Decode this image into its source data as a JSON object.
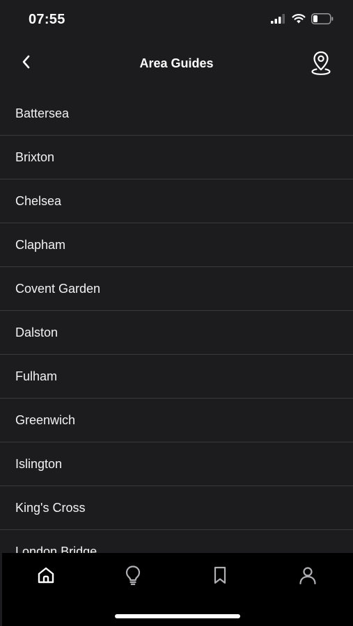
{
  "status_bar": {
    "time": "07:55",
    "icons": [
      "signal-icon",
      "wifi-icon",
      "battery-icon"
    ]
  },
  "header": {
    "title": "Area Guides",
    "back_icon": "chevron-left-icon",
    "map_icon": "map-pin-icon"
  },
  "areas": [
    {
      "label": "Battersea"
    },
    {
      "label": "Brixton"
    },
    {
      "label": "Chelsea"
    },
    {
      "label": "Clapham"
    },
    {
      "label": "Covent Garden"
    },
    {
      "label": "Dalston"
    },
    {
      "label": "Fulham"
    },
    {
      "label": "Greenwich"
    },
    {
      "label": "Islington"
    },
    {
      "label": "King's Cross"
    },
    {
      "label": "London Bridge"
    }
  ],
  "tab_bar": {
    "tabs": [
      {
        "icon": "home-icon",
        "selected": true
      },
      {
        "icon": "lightbulb-icon",
        "selected": false
      },
      {
        "icon": "bookmark-icon",
        "selected": false
      },
      {
        "icon": "profile-icon",
        "selected": false
      }
    ]
  },
  "colors": {
    "background": "#1c1c1e",
    "divider": "#3a3a3c",
    "tab_bar": "#000000",
    "text": "#ffffff"
  }
}
